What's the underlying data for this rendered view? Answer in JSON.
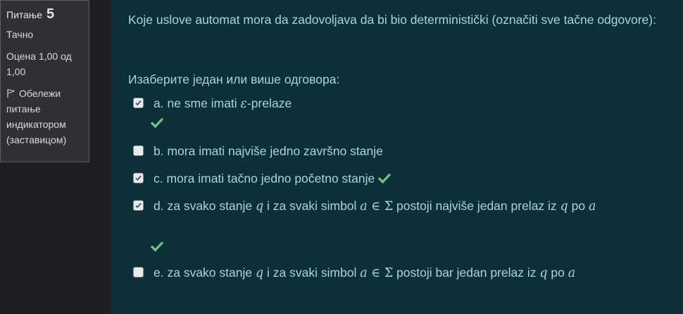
{
  "info": {
    "question_prefix": "Питање",
    "question_number": "5",
    "state": "Тачно",
    "grade": "Оцена 1,00 од 1,00",
    "flag_label": "Обележи питање индикатором (заставицом)"
  },
  "question": {
    "text": "Koje uslove automat mora da zadovoljava da bi bio deterministički (označiti sve tačne odgovore):",
    "prompt": "Изаберите један или више одговора:"
  },
  "options": [
    {
      "letter": "a.",
      "text_before": "ne sme imati ",
      "math": "ε",
      "text_after": "-prelaze",
      "checked": true,
      "correct": true
    },
    {
      "letter": "b.",
      "text": "mora imati najviše jedno završno stanje",
      "checked": false
    },
    {
      "letter": "c.",
      "text": "mora imati tačno jedno početno stanje",
      "checked": true,
      "correct": true
    },
    {
      "letter": "d.",
      "p1": "za svako stanje ",
      "m1": "q",
      "p2": " i za svaki simbol ",
      "m2": "a",
      "m3": " ∈ Σ",
      "p3": " postoji najviše jedan prelaz iz ",
      "m4": "q",
      "p4": " po ",
      "m5": "a",
      "checked": true,
      "correct": true
    },
    {
      "letter": "e.",
      "p1": "za svako stanje ",
      "m1": "q",
      "p2": " i za svaki simbol ",
      "m2": "a",
      "m3": " ∈ Σ",
      "p3": " postoji bar jedan prelaz iz ",
      "m4": "q",
      "p4": " po ",
      "m5": "a",
      "checked": false
    }
  ],
  "colors": {
    "accent_text": "#a9d3df",
    "check_green": "#6ec07a",
    "panel_bg": "#0d3038"
  }
}
